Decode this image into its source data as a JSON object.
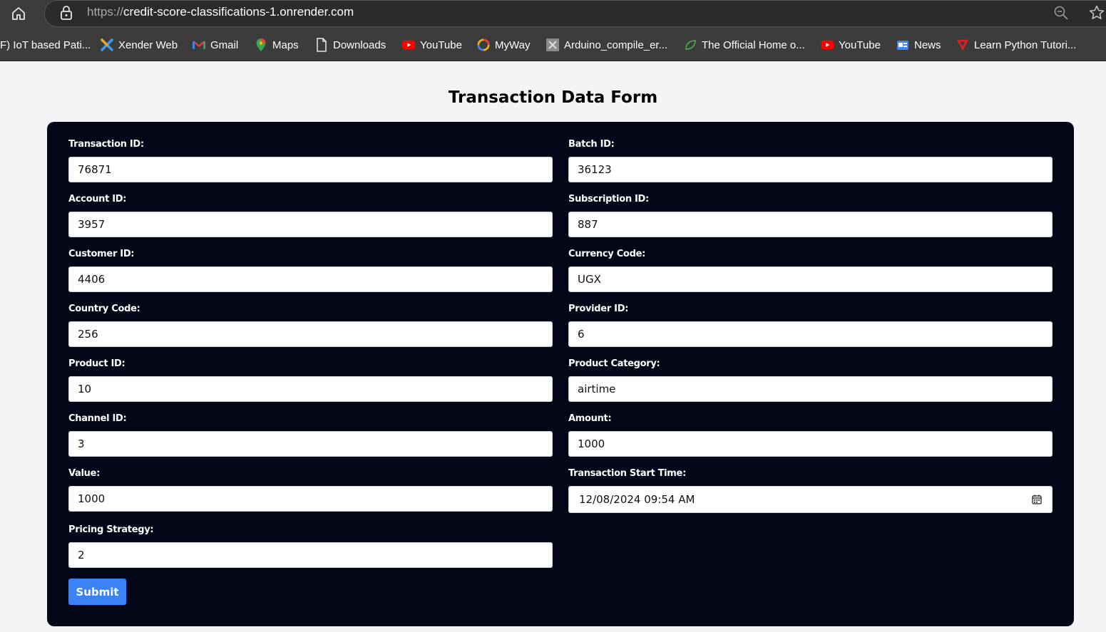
{
  "browser": {
    "url_scheme": "https://",
    "url_host": "credit-score-classifications-1.onrender.com",
    "bookmarks": [
      {
        "label": "F) IoT based Pati...",
        "icon": "doc-icon"
      },
      {
        "label": "Xender Web",
        "icon": "xender-icon"
      },
      {
        "label": "Gmail",
        "icon": "gmail-icon"
      },
      {
        "label": "Maps",
        "icon": "maps-icon"
      },
      {
        "label": "Downloads",
        "icon": "file-icon"
      },
      {
        "label": "YouTube",
        "icon": "youtube-icon"
      },
      {
        "label": "MyWay",
        "icon": "myway-icon"
      },
      {
        "label": "Arduino_compile_er...",
        "icon": "arduino-icon"
      },
      {
        "label": "The Official Home o...",
        "icon": "leaf-icon"
      },
      {
        "label": "YouTube",
        "icon": "youtube-icon"
      },
      {
        "label": "News",
        "icon": "news-icon"
      },
      {
        "label": "Learn Python Tutori...",
        "icon": "python-tutorial-icon"
      }
    ]
  },
  "page": {
    "title": "Transaction Data Form"
  },
  "form": {
    "fields": [
      {
        "label": "Transaction ID:",
        "value": "76871"
      },
      {
        "label": "Batch ID:",
        "value": "36123"
      },
      {
        "label": "Account ID:",
        "value": "3957"
      },
      {
        "label": "Subscription ID:",
        "value": "887"
      },
      {
        "label": "Customer ID:",
        "value": "4406"
      },
      {
        "label": "Currency Code:",
        "value": "UGX"
      },
      {
        "label": "Country Code:",
        "value": "256"
      },
      {
        "label": "Provider ID:",
        "value": "6"
      },
      {
        "label": "Product ID:",
        "value": "10"
      },
      {
        "label": "Product Category:",
        "value": "airtime"
      },
      {
        "label": "Channel ID:",
        "value": "3"
      },
      {
        "label": "Amount:",
        "value": "1000"
      },
      {
        "label": "Value:",
        "value": "1000"
      },
      {
        "label": "Transaction Start Time:",
        "value": "12/08/2024 09:54 AM"
      },
      {
        "label": "Pricing Strategy:",
        "value": "2"
      }
    ],
    "submit_label": "Submit"
  },
  "colors": {
    "card_bg": "#020617",
    "submit_bg": "#3b82f6",
    "page_bg": "#f3f4f6"
  }
}
